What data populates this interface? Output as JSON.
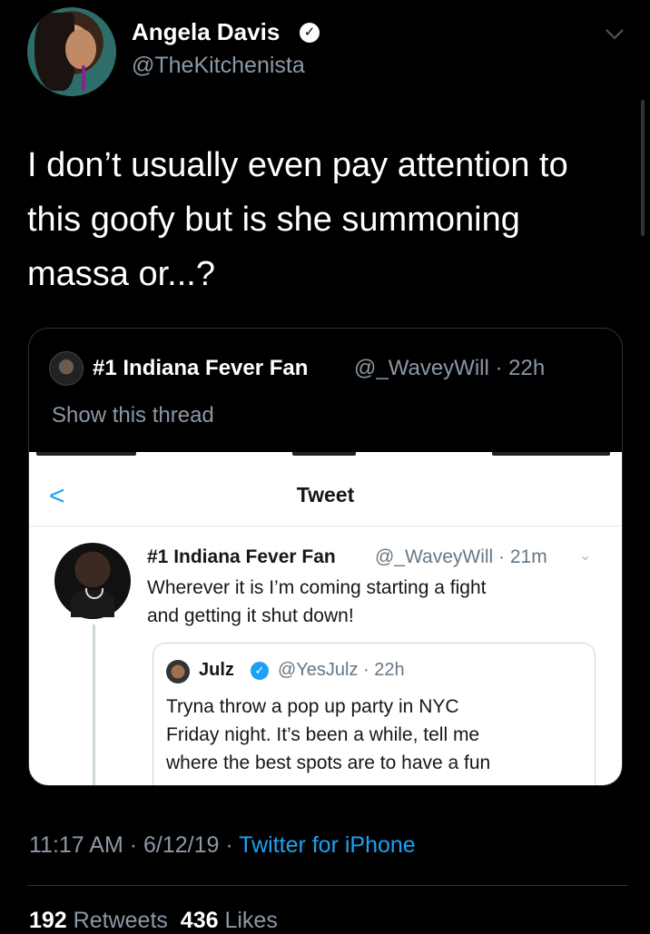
{
  "author": {
    "name": "Angela Davis",
    "handle": "@TheKitchenista",
    "verified_icon": "verified-badge-icon"
  },
  "tweet": {
    "text": "I don’t usually even pay attention to\nthis goofy but is she summoning\nmassa or...?"
  },
  "quoted": {
    "name": "#1 Indiana Fever Fan",
    "meta": "@_WaveyWill · 22h",
    "show_thread": "Show this thread",
    "screenshot": {
      "nav_back": "<",
      "nav_title": "Tweet",
      "inner_tweet": {
        "name": "#1 Indiana Fever Fan",
        "meta": "@_WaveyWill · 21m",
        "text": "Wherever it is I’m coming starting a fight\nand getting it shut down!"
      },
      "nested_tweet": {
        "name": "Julz",
        "meta": "@YesJulz · 22h",
        "text": "Tryna throw a pop up party in NYC\nFriday night. It’s been a while, tell me\nwhere the best spots are to have a fun"
      }
    }
  },
  "footer": {
    "time_date": "11:17 AM · 6/12/19 · ",
    "source": "Twitter for iPhone",
    "retweets_count": "192",
    "retweets_label": "Retweets",
    "likes_count": "436",
    "likes_label": "Likes"
  },
  "colors": {
    "background": "#000000",
    "secondary_text": "#8b98a5",
    "accent": "#1da1f2"
  }
}
